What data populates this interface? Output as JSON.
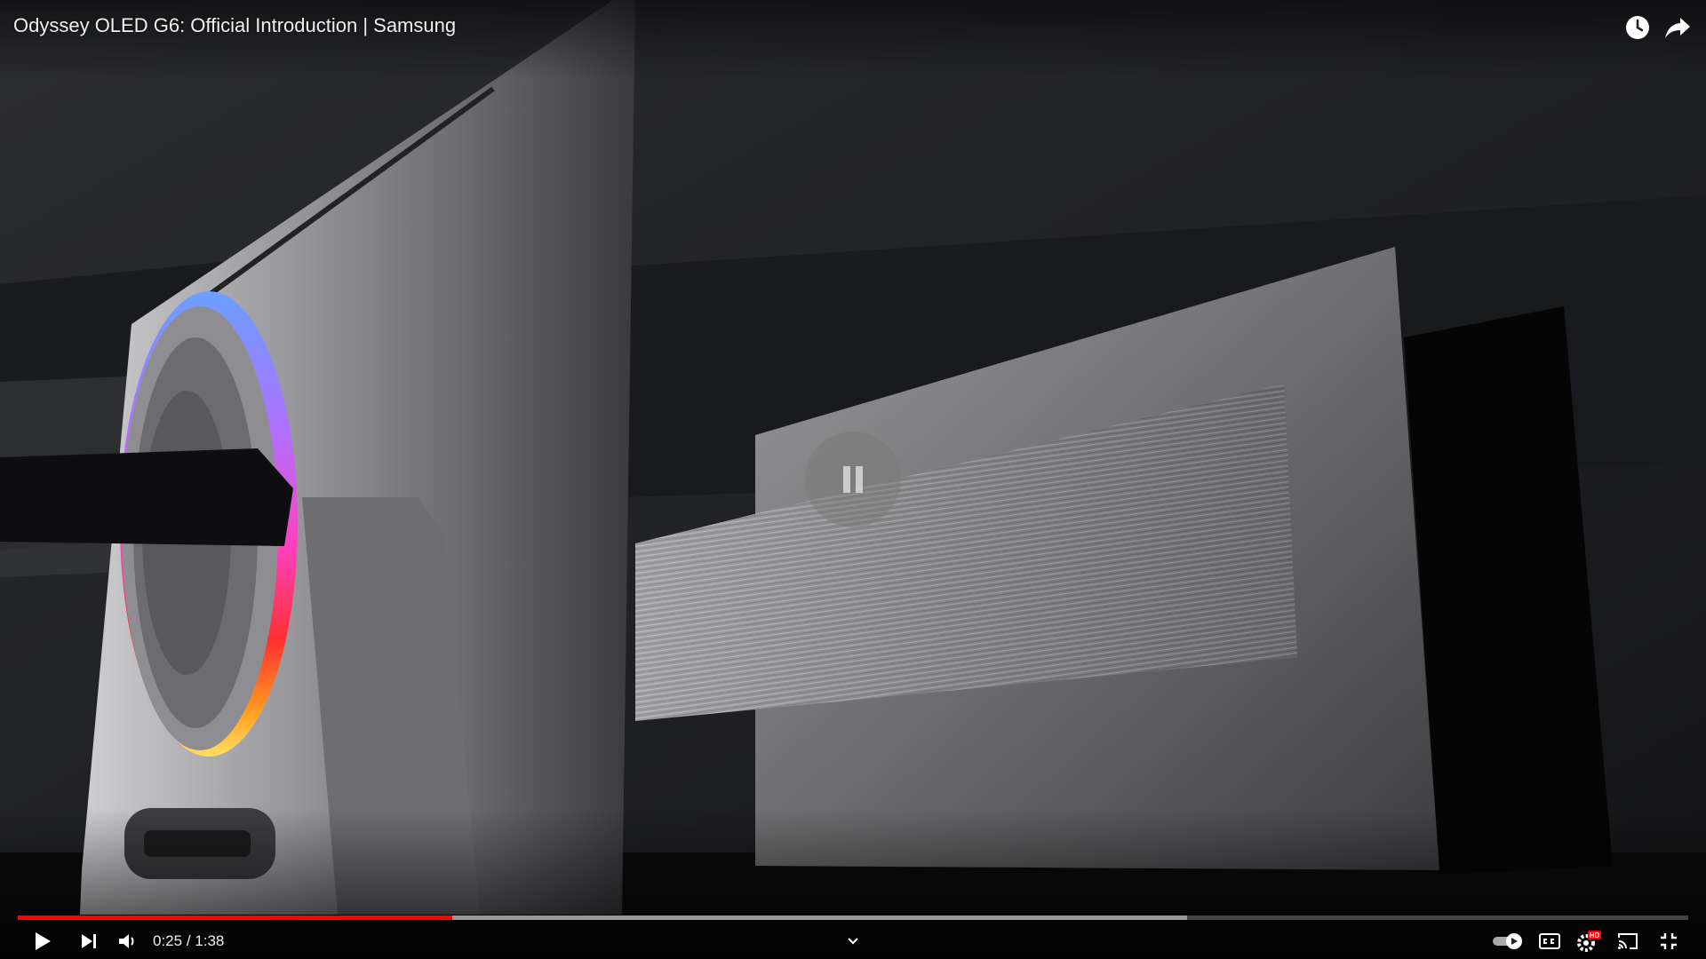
{
  "video": {
    "title": "Odyssey OLED G6: Official Introduction | Samsung",
    "current_time": "0:25",
    "duration": "1:38",
    "time_separator": " / ",
    "progress_played_fraction": 0.26,
    "progress_buffered_fraction": 0.7,
    "accent_color": "#ff0000"
  },
  "top_icons": [
    "watch-later-icon",
    "share-icon"
  ],
  "controls": {
    "left": [
      "play-icon",
      "next-icon",
      "volume-icon"
    ],
    "center": [
      "chevron-down-icon"
    ],
    "right": [
      "autoplay-toggle-icon",
      "subtitles-icon",
      "settings-icon",
      "cast-icon",
      "exit-fullscreen-icon"
    ],
    "settings_badge": "HD"
  }
}
